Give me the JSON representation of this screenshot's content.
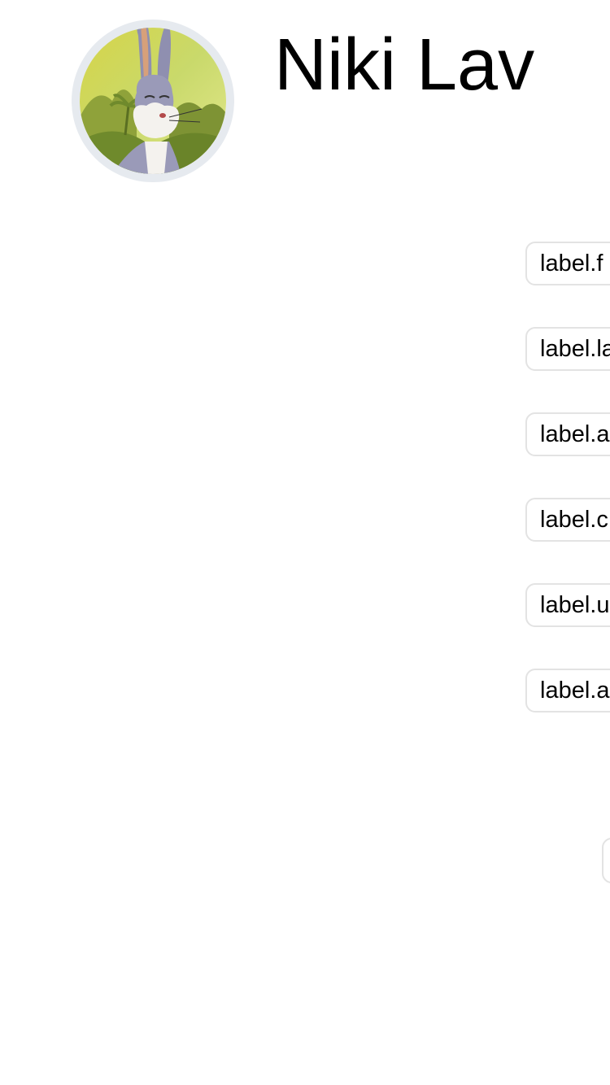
{
  "profile": {
    "name": "Niki Lav",
    "avatar_icon": "rabbit-cartoon-avatar"
  },
  "fields": [
    {
      "label": "label.f"
    },
    {
      "label": "label.la"
    },
    {
      "label": "label.a"
    },
    {
      "label": "label.c"
    },
    {
      "label": "label.u"
    },
    {
      "label": "label.a"
    }
  ],
  "colors": {
    "avatar_ring": "#e6eaef",
    "chip_border": "#e3e3e3"
  }
}
